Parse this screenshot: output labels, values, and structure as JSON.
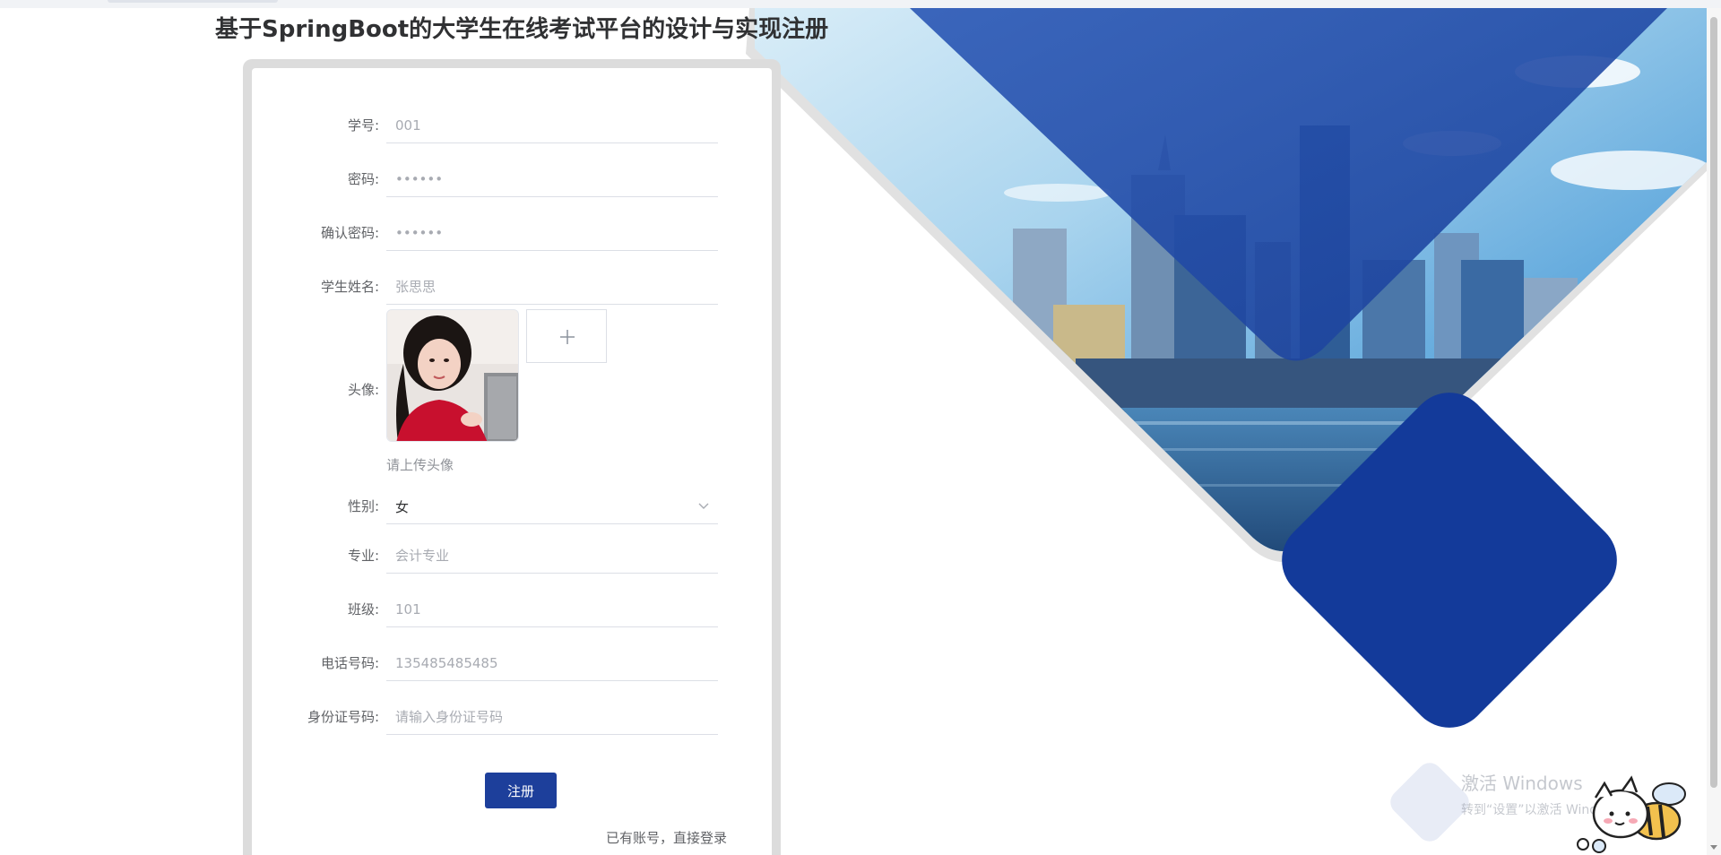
{
  "page": {
    "title": "基于SpringBoot的大学生在线考试平台的设计与实现注册"
  },
  "form": {
    "student_id": {
      "label": "学号:",
      "placeholder": "001"
    },
    "password": {
      "label": "密码:",
      "placeholder": "••••••"
    },
    "confirm_password": {
      "label": "确认密码:",
      "placeholder": "••••••"
    },
    "student_name": {
      "label": "学生姓名:",
      "placeholder": "张思思"
    },
    "avatar": {
      "label": "头像:",
      "hint": "请上传头像"
    },
    "gender": {
      "label": "性别:",
      "value": "女"
    },
    "major": {
      "label": "专业:",
      "placeholder": "会计专业"
    },
    "class": {
      "label": "班级:",
      "placeholder": "101"
    },
    "phone": {
      "label": "电话号码:",
      "placeholder": "135485485485"
    },
    "id_card": {
      "label": "身份证号码:",
      "placeholder": "请输入身份证号码"
    },
    "submit_label": "注册",
    "login_link": "已有账号，直接登录"
  },
  "os_watermark": {
    "line1": "激活 Windows",
    "line2": "转到“设置”以激活 Windows。"
  },
  "colors": {
    "primary": "#1d3f9b",
    "deep_blue": "#133a9a",
    "card_frame": "#dcdcdc"
  },
  "icons": {
    "upload": "plus-icon",
    "select": "chevron-down-icon"
  }
}
